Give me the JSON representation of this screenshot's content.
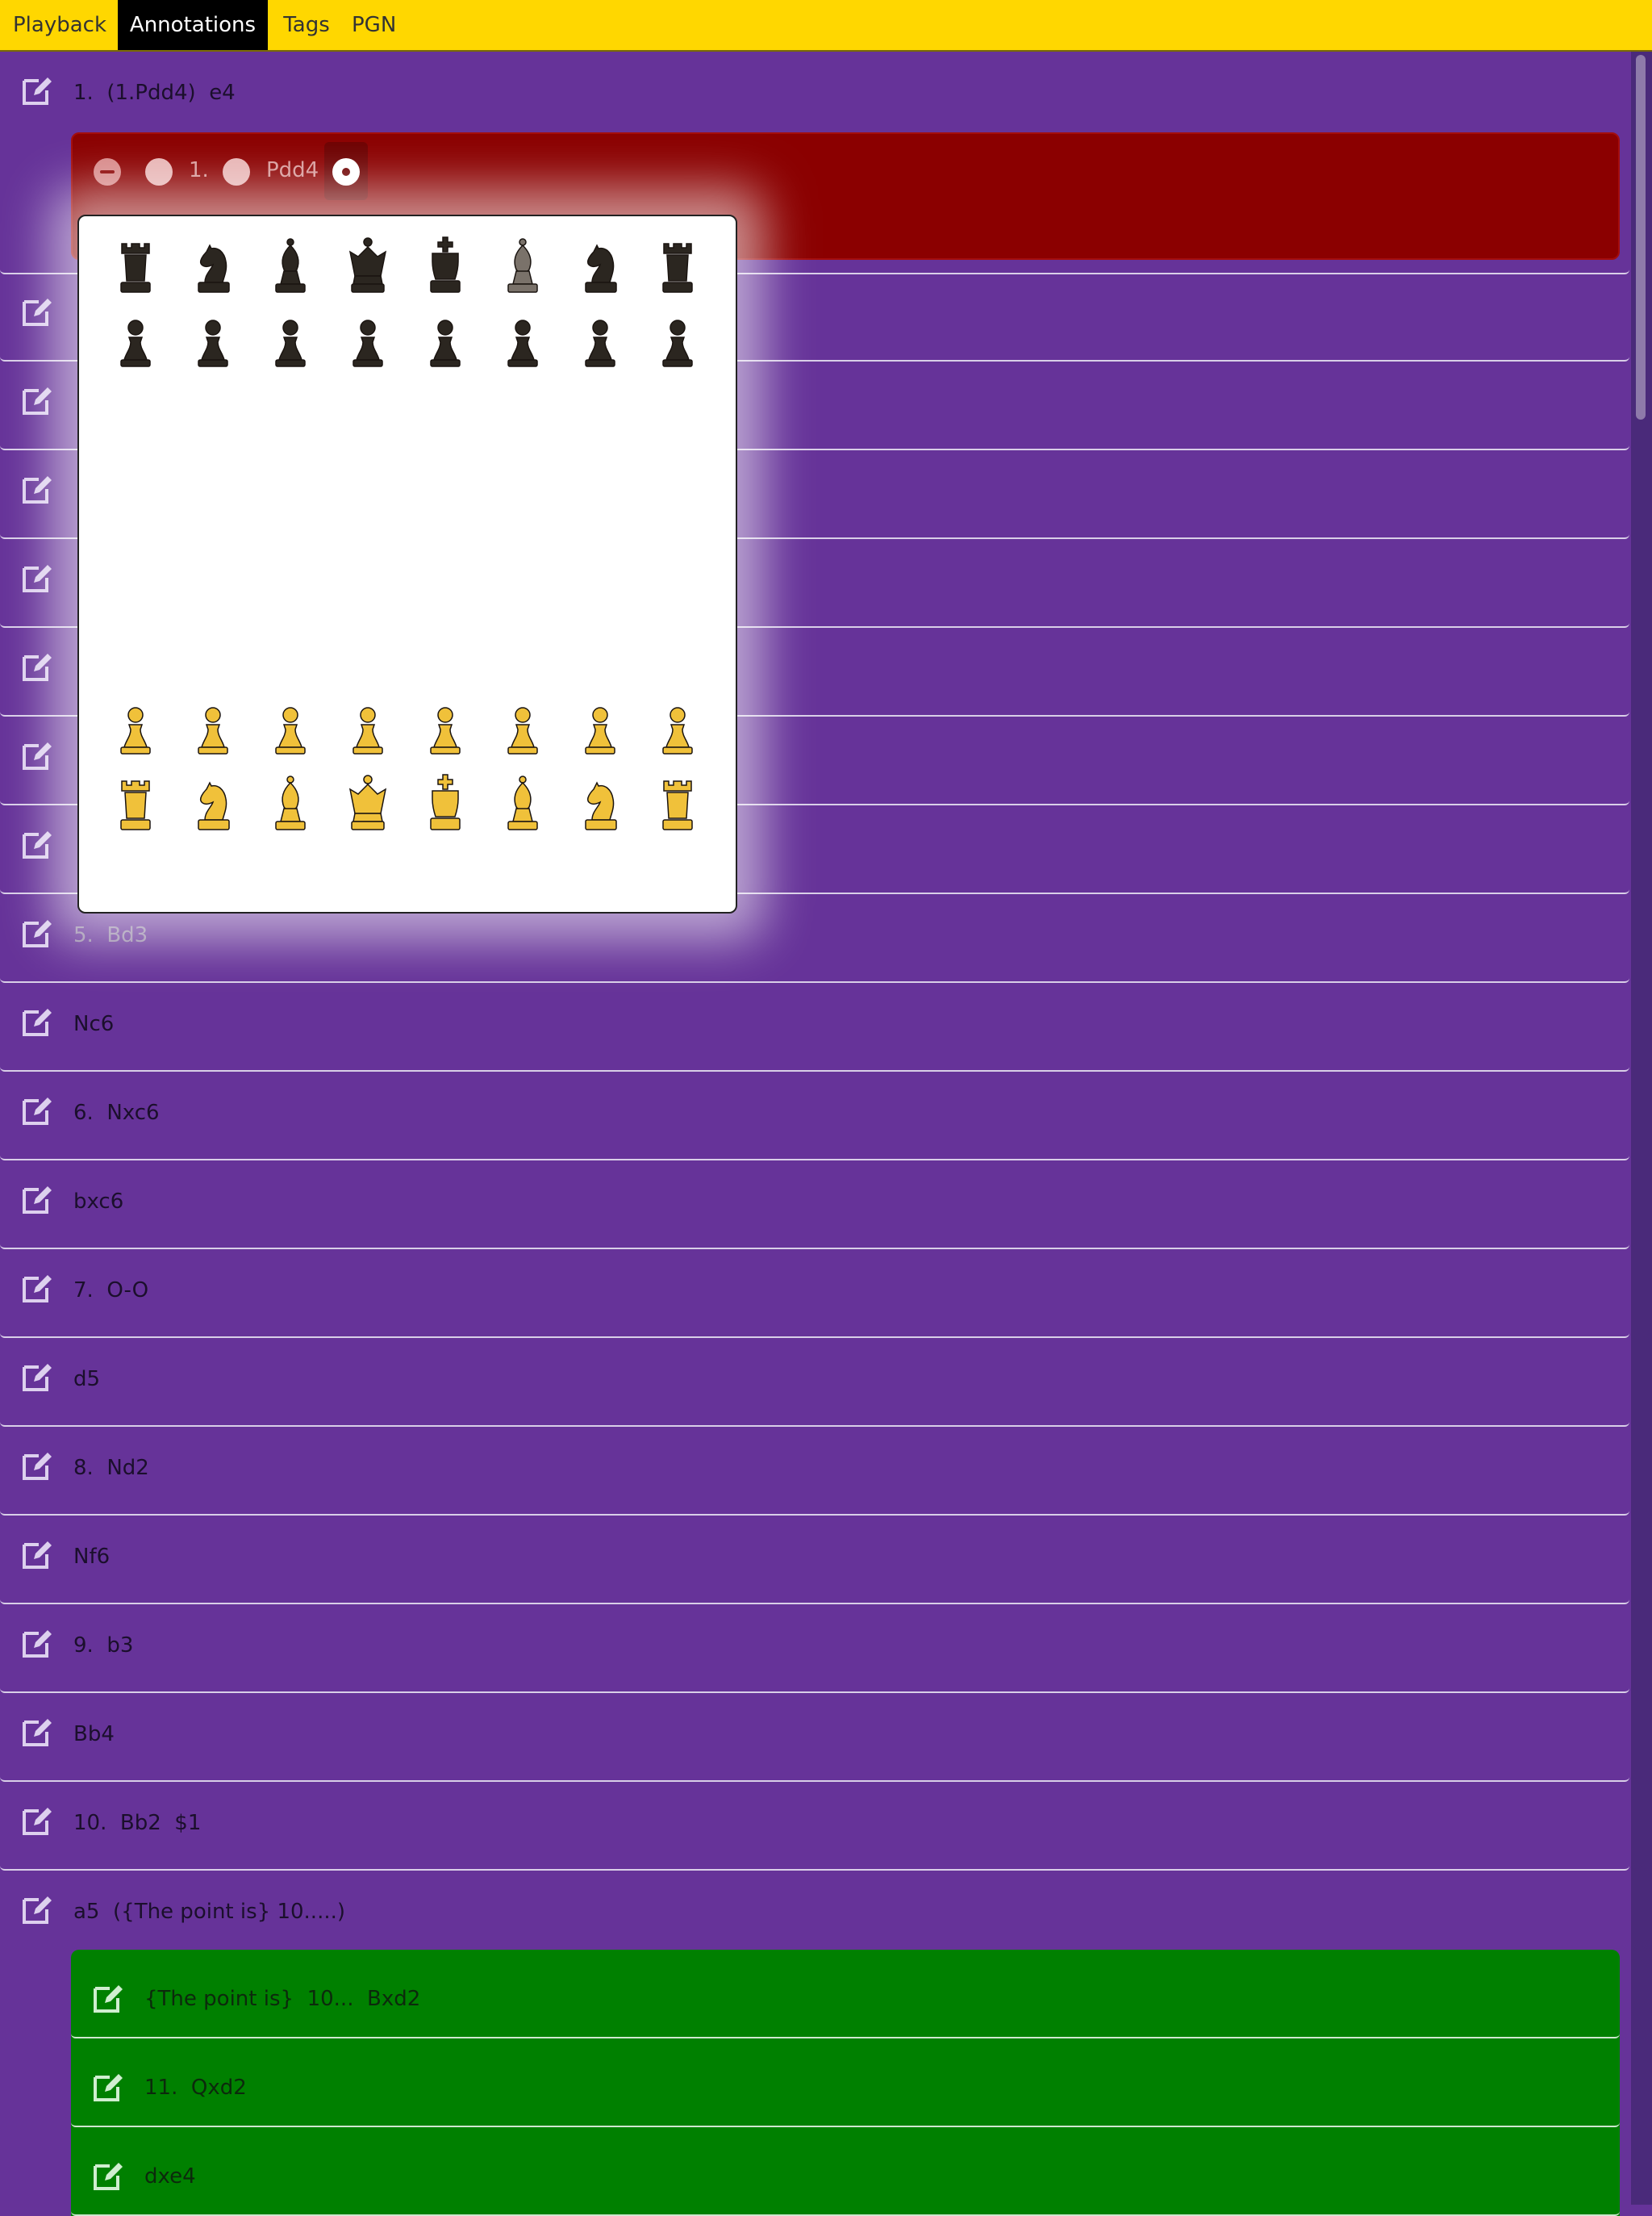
{
  "tabs": {
    "playback": "Playback",
    "annotations": "Annotations",
    "tags": "Tags",
    "pgn": "PGN",
    "active": "Annotations"
  },
  "rows": [
    {
      "text": "1.  (1.Pdd4)  e4"
    },
    {
      "text": ""
    },
    {
      "text": ""
    },
    {
      "text": ""
    },
    {
      "text": ""
    },
    {
      "text": ""
    },
    {
      "text": ""
    },
    {
      "text": ""
    },
    {
      "text": "5.  Bd3"
    },
    {
      "text": "Nc6"
    },
    {
      "text": "6.  Nxc6"
    },
    {
      "text": "bxc6"
    },
    {
      "text": "7.  O-O"
    },
    {
      "text": "d5"
    },
    {
      "text": "8.  Nd2"
    },
    {
      "text": "Nf6"
    },
    {
      "text": "9.  b3"
    },
    {
      "text": "Bb4"
    },
    {
      "text": "10.  Bb2  $1"
    },
    {
      "text": "a5  ({The point is} 10.....)"
    }
  ],
  "variation_red": {
    "move_number": "1.",
    "move": "Pdd4"
  },
  "variation_green": [
    {
      "text": "{The point is}  10...  Bxd2"
    },
    {
      "text": "11.  Qxd2"
    },
    {
      "text": "dxe4"
    }
  ],
  "board": {
    "dark_color": "#2b2620",
    "light_color": "#f0c13a",
    "rank8": [
      "rook",
      "knight",
      "bishop",
      "queen",
      "king",
      "bishop",
      "knight",
      "rook"
    ],
    "rank7": [
      "pawn",
      "pawn",
      "pawn",
      "pawn",
      "pawn",
      "pawn",
      "pawn",
      "pawn"
    ],
    "rank2": [
      "pawn",
      "pawn",
      "pawn",
      "pawn",
      "pawn",
      "pawn",
      "pawn",
      "pawn"
    ],
    "rank1": [
      "rook",
      "knight",
      "bishop",
      "queen",
      "king",
      "bishop",
      "knight",
      "rook"
    ]
  },
  "colors": {
    "background": "#663399",
    "tabbar": "#ffd700",
    "active_tab": "#000000",
    "variation_red": "#8b0000",
    "variation_green": "#008000"
  }
}
